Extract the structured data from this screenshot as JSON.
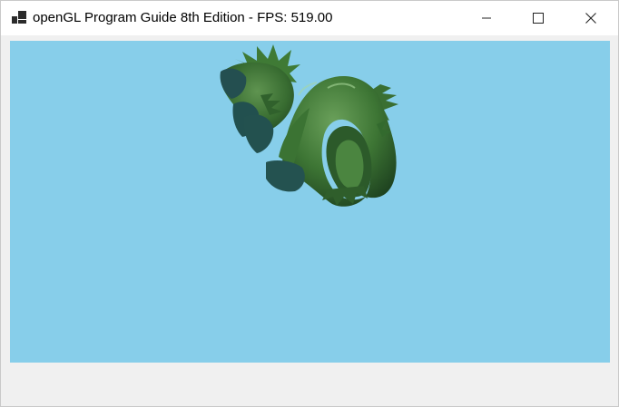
{
  "window": {
    "title": "openGL Program Guide 8th Edition - FPS: 519.00"
  },
  "icons": {
    "app": "app-icon",
    "minimize": "minimize-icon",
    "maximize": "maximize-icon",
    "close": "close-icon"
  },
  "colors": {
    "viewport_background": "#87ceea",
    "dragon_body": "#3f7a35",
    "dragon_shadow": "#234f4f",
    "titlebar": "#ffffff",
    "client_background": "#f0f0f0"
  },
  "scene": {
    "model": "dragon"
  }
}
